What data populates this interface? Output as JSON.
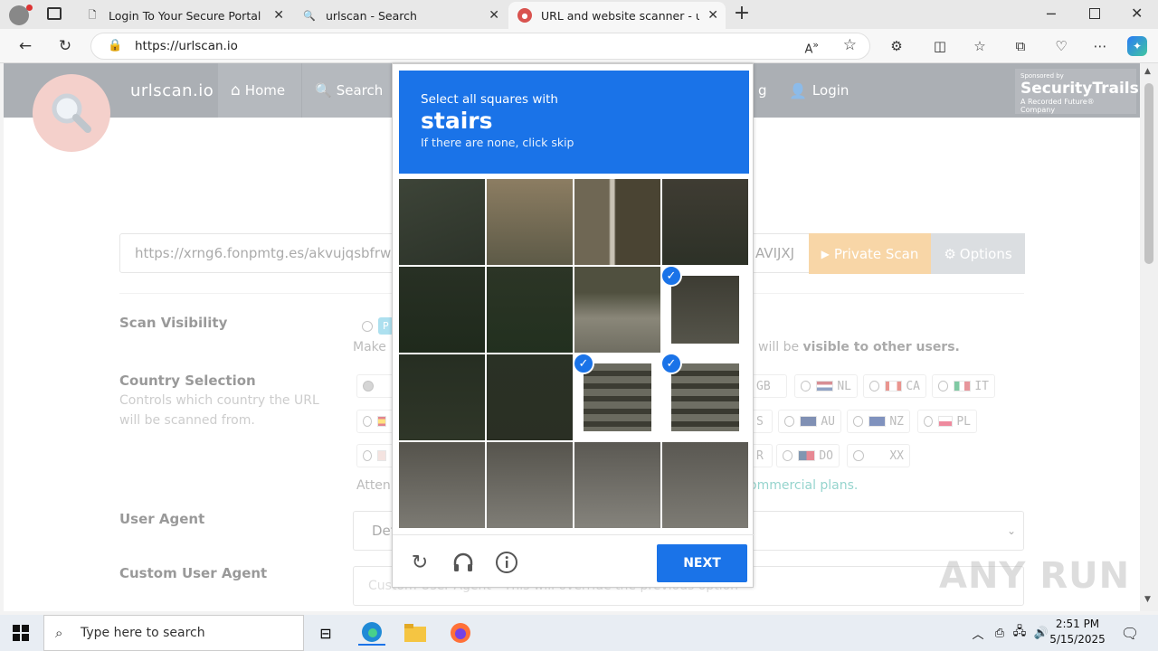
{
  "browser": {
    "tabs": [
      {
        "title": "Login To Your Secure Portal"
      },
      {
        "title": "urlscan - Search"
      },
      {
        "title": "URL and website scanner - urlsca"
      }
    ],
    "url": "https://urlscan.io"
  },
  "site": {
    "brand": "urlscan.io",
    "nav": [
      "Home",
      "Search",
      "g",
      "Login"
    ],
    "sponsor_top": "Sponsored by",
    "sponsor_name": "SecurityTrails",
    "sponsor_sub": "A Recorded Future® Company",
    "scan_url_value": "https://xrng6.fonpmtg.es/akvujqsbfrwxnsnl",
    "scan_url_tail": "AVIJXJ",
    "private_scan": "Private Scan",
    "options": "Options",
    "scan_visibility_label": "Scan Visibility",
    "visibility_chip": "P",
    "visibility_note_start": "Make",
    "visibility_note_mid": "will be",
    "visibility_note_bold": "visible to other users.",
    "country_label": "Country Selection",
    "country_help": "Controls which country the URL will be scanned from.",
    "countries_row1": [
      "GB",
      "NL",
      "CA",
      "IT"
    ],
    "countries_row2": [
      "S",
      "AU",
      "NZ",
      "PL"
    ],
    "countries_row3": [
      "R",
      "DO",
      "XX"
    ],
    "attention_start": "Atten",
    "attention_link": "ommercial plans.",
    "user_agent_label": "User Agent",
    "user_agent_value": "Det",
    "custom_ua_label": "Custom User Agent",
    "custom_ua_placeholder": "Custom User Agent - This will override the previous option"
  },
  "captcha": {
    "instruction": "Select all squares with",
    "target": "stairs",
    "hint": "If there are none, click skip",
    "selected_cells": [
      7,
      10,
      11
    ],
    "next_label": "NEXT"
  },
  "taskbar": {
    "search_placeholder": "Type here to search",
    "time": "2:51 PM",
    "date": "5/15/2025"
  },
  "watermark": "ANY RUN"
}
